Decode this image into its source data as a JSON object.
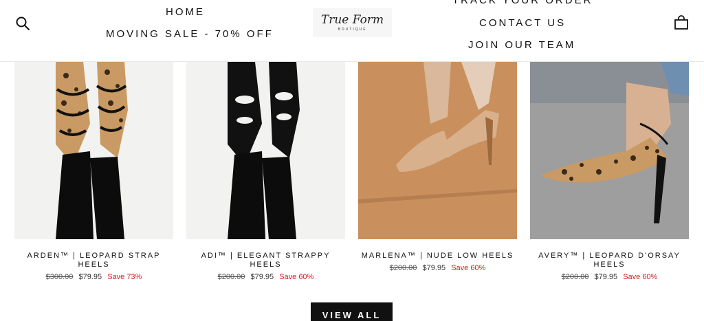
{
  "header": {
    "nav_left": [
      "HOME",
      "MOVING SALE - 70% OFF"
    ],
    "nav_right": [
      "TRACK YOUR ORDER",
      "CONTACT US",
      "JOIN OUR TEAM"
    ],
    "logo_main": "True Form",
    "logo_sub": "BOUTIQUE"
  },
  "products": [
    {
      "title": "ARDEN™ | LEOPARD STRAP HEELS",
      "price_old": "$300.00",
      "price_new": "$79.95",
      "save": "Save 73%"
    },
    {
      "title": "ADI™ | ELEGANT STRAPPY HEELS",
      "price_old": "$200.00",
      "price_new": "$79.95",
      "save": "Save 60%"
    },
    {
      "title": "MARLENA™ | NUDE LOW HEELS",
      "price_old": "$200.00",
      "price_new": "$79.95",
      "save": "Save 60%"
    },
    {
      "title": "AVERY™ | LEOPARD D'ORSAY HEELS",
      "price_old": "$200.00",
      "price_new": "$79.95",
      "save": "Save 60%"
    }
  ],
  "view_all_label": "VIEW ALL",
  "colors": {
    "accent_sale": "#c8261b",
    "button_bg": "#111111"
  }
}
